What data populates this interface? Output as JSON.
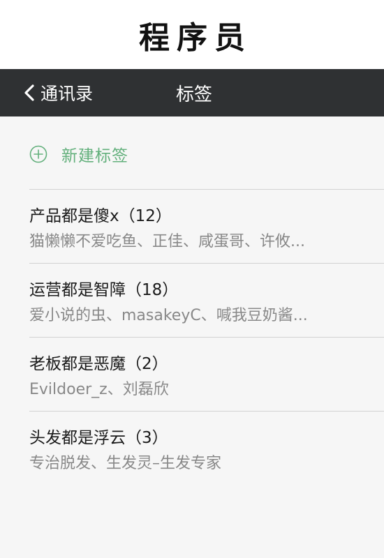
{
  "caption": {
    "text": "程序员"
  },
  "navbar": {
    "back_label": "通讯录",
    "title": "标签"
  },
  "new_tag": {
    "label": "新建标签"
  },
  "tags": [
    {
      "title": "产品都是傻x（12）",
      "members": "猫懒懒不爱吃鱼、正佳、咸蛋哥、许攸..."
    },
    {
      "title": "运营都是智障（18）",
      "members": "爱小说的虫、masakeyC、喊我豆奶酱..."
    },
    {
      "title": "老板都是恶魔（2）",
      "members": "Evildoer_z、刘磊欣"
    },
    {
      "title": "头发都是浮云（3）",
      "members": "专治脱发、生发灵–生发专家"
    }
  ],
  "colors": {
    "navbar_bg": "#2f3133",
    "accent_green": "#63b07c",
    "content_bg": "#f6f6f6",
    "divider": "#d2d2d2"
  },
  "icons": {
    "back": "chevron-left-icon",
    "new_tag": "plus-circle-icon"
  }
}
